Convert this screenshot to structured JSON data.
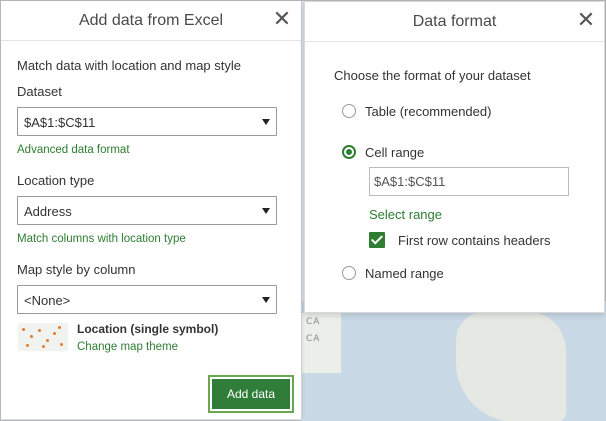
{
  "map": {
    "labels": [
      "CA",
      "CA"
    ]
  },
  "left_panel": {
    "title": "Add data from Excel",
    "close_glyph": "✕",
    "intro": "Match data with location and map style",
    "dataset_label": "Dataset",
    "dataset_value": "$A$1:$C$11",
    "advanced_link": "Advanced data format",
    "location_type_label": "Location type",
    "location_type_value": "Address",
    "match_columns_link": "Match columns with location type",
    "map_style_label": "Map style by column",
    "map_style_value": "<None>",
    "theme_title": "Location (single symbol)",
    "theme_link": "Change map theme",
    "add_button": "Add data"
  },
  "right_panel": {
    "title": "Data format",
    "close_glyph": "✕",
    "prompt": "Choose the format of your dataset",
    "options": [
      {
        "label": "Table (recommended)",
        "checked": false
      },
      {
        "label": "Cell range",
        "checked": true
      },
      {
        "label": "Named range",
        "checked": false
      }
    ],
    "range_value": "$A$1:$C$11",
    "select_range_link": "Select range",
    "first_row_headers": "First row contains headers",
    "first_row_checked": true
  },
  "colors": {
    "accent": "#2e7d32",
    "button": "#2f7d38",
    "button_outline": "#6aa84f"
  }
}
